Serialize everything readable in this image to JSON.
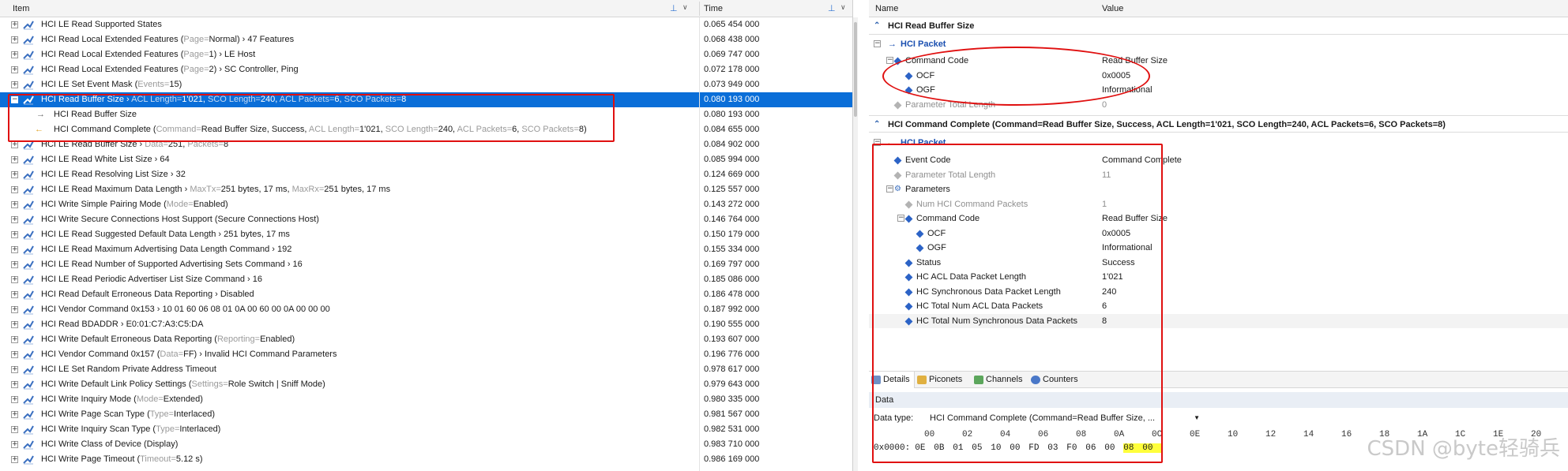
{
  "left_header": {
    "item": "Item",
    "time": "Time"
  },
  "rows": [
    {
      "label": "HCI LE Read Supported States",
      "time": "0.065 454 000"
    },
    {
      "label": "HCI Read Local Extended Features (Page=Normal) › 47 Features",
      "time": "0.068 438 000"
    },
    {
      "label": "HCI Read Local Extended Features (Page=1) › LE Host",
      "time": "0.069 747 000"
    },
    {
      "label": "HCI Read Local Extended Features (Page=2) › SC Controller, Ping",
      "time": "0.072 178 000"
    },
    {
      "label": "HCI LE Set Event Mask (Events=15)",
      "time": "0.073 949 000"
    },
    {
      "label": "HCI Read Buffer Size › ACL Length=1'021, SCO Length=240, ACL Packets=6, SCO Packets=8",
      "time": "0.080 193 000"
    },
    {
      "label": "HCI Read Buffer Size",
      "time": "0.080 193 000"
    },
    {
      "label": "HCI Command Complete (Command=Read Buffer Size, Success, ACL Length=1'021, SCO Length=240, ACL Packets=6, SCO Packets=8)",
      "time": "0.084 655 000"
    },
    {
      "label": "HCI LE Read Buffer Size › Data=251, Packets=8",
      "time": "0.084 902 000"
    },
    {
      "label": "HCI LE Read White List Size › 64",
      "time": "0.085 994 000"
    },
    {
      "label": "HCI LE Read Resolving List Size › 32",
      "time": "0.124 669 000"
    },
    {
      "label": "HCI LE Read Maximum Data Length › MaxTx=251 bytes, 17 ms, MaxRx=251 bytes, 17 ms",
      "time": "0.125 557 000"
    },
    {
      "label": "HCI Write Simple Pairing Mode (Mode=Enabled)",
      "time": "0.143 272 000"
    },
    {
      "label": "HCI Write Secure Connections Host Support (Secure Connections Host)",
      "time": "0.146 764 000"
    },
    {
      "label": "HCI LE Read Suggested Default Data Length › 251 bytes, 17 ms",
      "time": "0.150 179 000"
    },
    {
      "label": "HCI LE Read Maximum Advertising Data Length Command › 192",
      "time": "0.155 334 000"
    },
    {
      "label": "HCI LE Read Number of Supported Advertising Sets Command › 16",
      "time": "0.169 797 000"
    },
    {
      "label": "HCI LE Read Periodic Advertiser List Size Command › 16",
      "time": "0.185 086 000"
    },
    {
      "label": "HCI Read Default Erroneous Data Reporting › Disabled",
      "time": "0.186 478 000"
    },
    {
      "label": "HCI Vendor Command 0x153 › 10 01 60 06 08 01 0A 00 60 00 0A 00 00 00",
      "time": "0.187 992 000"
    },
    {
      "label": "HCI Read BDADDR › E0:01:C7:A3:C5:DA",
      "time": "0.190 555 000"
    },
    {
      "label": "HCI Write Default Erroneous Data Reporting (Reporting=Enabled)",
      "time": "0.193 607 000"
    },
    {
      "label": "HCI Vendor Command 0x157 (Data=FF) › Invalid HCI Command Parameters",
      "time": "0.196 776 000"
    },
    {
      "label": "HCI LE Set Random Private Address Timeout",
      "time": "0.978 617 000"
    },
    {
      "label": "HCI Write Default Link Policy Settings (Settings=Role Switch | Sniff Mode)",
      "time": "0.979 643 000"
    },
    {
      "label": "HCI Write Inquiry Mode (Mode=Extended)",
      "time": "0.980 335 000"
    },
    {
      "label": "HCI Write Page Scan Type (Type=Interlaced)",
      "time": "0.981 567 000"
    },
    {
      "label": "HCI Write Inquiry Scan Type (Type=Interlaced)",
      "time": "0.982 531 000"
    },
    {
      "label": "HCI Write Class of Device (Display)",
      "time": "0.983 710 000"
    },
    {
      "label": "HCI Write Page Timeout (Timeout=5.12 s)",
      "time": "0.986 169 000"
    }
  ],
  "right_header": {
    "name": "Name",
    "value": "Value"
  },
  "sec1": {
    "title": "HCI Read Buffer Size",
    "packet": "HCI Packet",
    "rows": [
      {
        "name": "Command Code",
        "value": "Read Buffer Size"
      },
      {
        "name": "OCF",
        "value": "0x0005"
      },
      {
        "name": "OGF",
        "value": "Informational"
      },
      {
        "name": "Parameter Total Length",
        "value": "0"
      }
    ]
  },
  "sec2": {
    "title": "HCI Command Complete (Command=Read Buffer Size, Success, ACL Length=1'021, SCO Length=240, ACL Packets=6, SCO Packets=8)",
    "packet": "HCI Packet",
    "rows": [
      {
        "name": "Event Code",
        "value": "Command Complete"
      },
      {
        "name": "Parameter Total Length",
        "value": "11"
      },
      {
        "name": "Parameters",
        "value": ""
      },
      {
        "name": "Num HCI Command Packets",
        "value": "1"
      },
      {
        "name": "Command Code",
        "value": "Read Buffer Size"
      },
      {
        "name": "OCF",
        "value": "0x0005"
      },
      {
        "name": "OGF",
        "value": "Informational"
      },
      {
        "name": "Status",
        "value": "Success"
      },
      {
        "name": "HC ACL Data Packet Length",
        "value": "1'021"
      },
      {
        "name": "HC Synchronous Data Packet Length",
        "value": "240"
      },
      {
        "name": "HC Total Num ACL Data Packets",
        "value": "6"
      },
      {
        "name": "HC Total Num Synchronous Data Packets",
        "value": "8"
      }
    ]
  },
  "tabs": [
    "Details",
    "Piconets",
    "Channels",
    "Counters"
  ],
  "data_panel": {
    "header": "Data",
    "type_label": "Data type:",
    "type_value": "HCI Command Complete (Command=Read Buffer Size, ...",
    "hex_columns": [
      "00",
      "02",
      "04",
      "06",
      "08",
      "0A",
      "0C",
      "0E",
      "10",
      "12",
      "14",
      "16",
      "18",
      "1A",
      "1C",
      "1E",
      "20"
    ],
    "offset": "0x0000:",
    "bytes": [
      "0E",
      "0B",
      "01",
      "05",
      "10",
      "00",
      "FD",
      "03",
      "F0",
      "06",
      "00",
      "08",
      "00"
    ],
    "highlighted_bytes": [
      11,
      12
    ]
  },
  "watermark": "CSDN @byte轻骑兵",
  "colors": {
    "selection": "#0a6ed8",
    "packet_blue": "#1a4fb0",
    "annotation_red": "#e01010",
    "byte_highlight": "#ffff3c"
  }
}
